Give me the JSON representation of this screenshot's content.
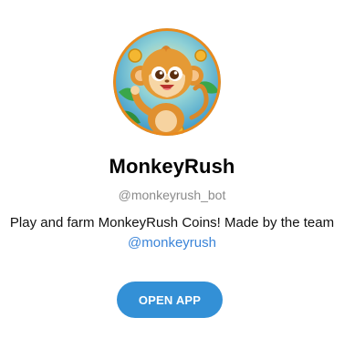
{
  "bot": {
    "name": "MonkeyRush",
    "username": "@monkeyrush_bot",
    "description_text": "Play and farm MonkeyRush Coins! Made by the team ",
    "description_mention": "@monkeyrush",
    "avatar_icon": "monkey-mascot-icon"
  },
  "actions": {
    "open_app_label": "OPEN APP"
  },
  "colors": {
    "button": "#3390d6",
    "mention": "#3a84d8",
    "username": "#8a8a8a"
  }
}
